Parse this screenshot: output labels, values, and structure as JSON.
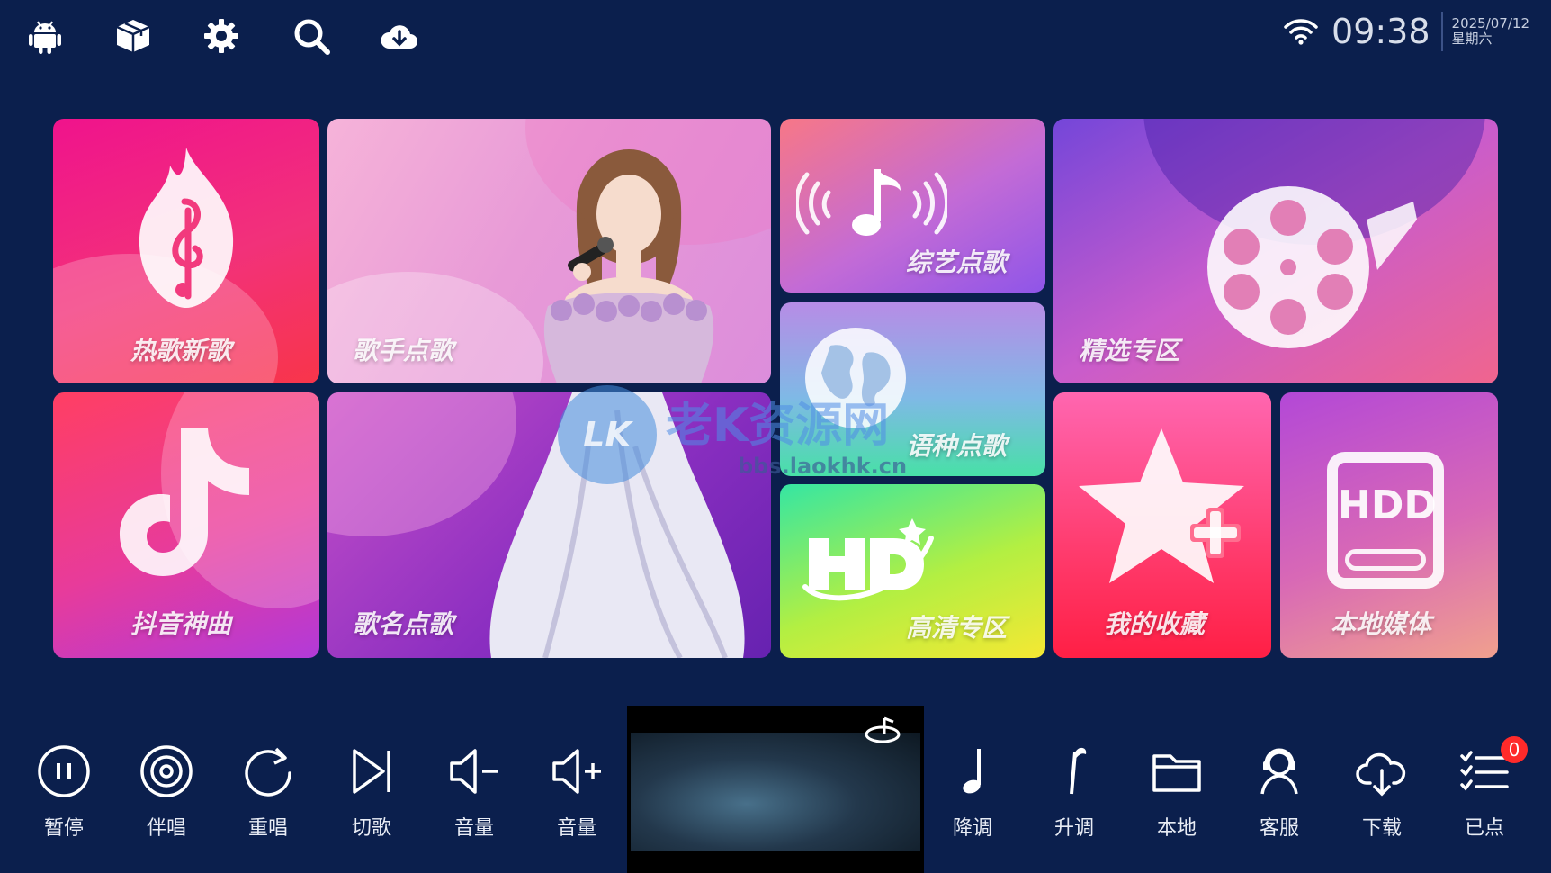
{
  "topbar": {
    "icons": [
      "android-icon",
      "box-icon",
      "gear-icon",
      "search-icon",
      "cloud-download-icon"
    ],
    "time": "09:38",
    "date": "2025/07/12",
    "weekday": "星期六"
  },
  "tiles": {
    "hot": "热歌新歌",
    "singer": "歌手点歌",
    "variety": "综艺点歌",
    "language": "语种点歌",
    "hd": "高清专区",
    "selected": "精选专区",
    "douyin": "抖音神曲",
    "title_search": "歌名点歌",
    "favorites": "我的收藏",
    "local_media": "本地媒体",
    "hdd_text": "HDD"
  },
  "watermark": {
    "text": "老K资源网",
    "url": "bbs.laokhk.cn",
    "logo": "LK"
  },
  "controls": {
    "pause": "暂停",
    "accompany": "伴唱",
    "replay": "重唱",
    "next": "切歌",
    "vol_down": "音量",
    "vol_up": "音量",
    "pitch_down": "降调",
    "pitch_up": "升调",
    "local": "本地",
    "service": "客服",
    "download": "下载",
    "queued": "已点",
    "queued_count": "0"
  },
  "colors": {
    "background": "#0b1f4d",
    "badge": "#ff2a2a"
  }
}
